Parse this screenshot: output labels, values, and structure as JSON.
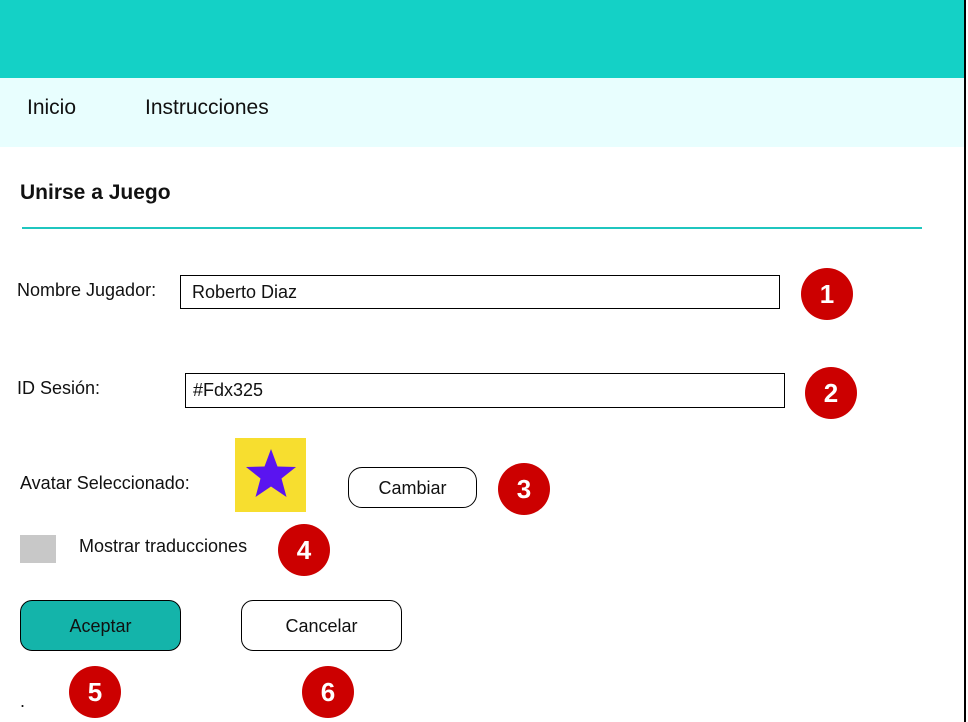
{
  "nav": {
    "items": [
      {
        "label": "Inicio"
      },
      {
        "label": "Instrucciones"
      }
    ]
  },
  "page": {
    "title": "Unirse a Juego"
  },
  "form": {
    "player_name": {
      "label": "Nombre Jugador:",
      "value": "Roberto Diaz"
    },
    "session_id": {
      "label": "ID Sesión:",
      "value": "#Fdx325"
    },
    "avatar": {
      "label": "Avatar Seleccionado:",
      "icon": "star-icon",
      "icon_color": "#5a14f0",
      "background_color": "#f7de2f",
      "change_label": "Cambiar"
    },
    "translations": {
      "label": "Mostrar traducciones",
      "checked": false
    }
  },
  "actions": {
    "accept_label": "Aceptar",
    "cancel_label": "Cancelar"
  },
  "annotations": {
    "markers": [
      "1",
      "2",
      "3",
      "4",
      "5",
      "6"
    ],
    "stray_text": "."
  },
  "colors": {
    "header": "#14d1c6",
    "nav_background": "#e8fefe",
    "accent_rule": "#1fc6bf",
    "primary_button": "#14b4aa",
    "marker": "#cc0000"
  }
}
